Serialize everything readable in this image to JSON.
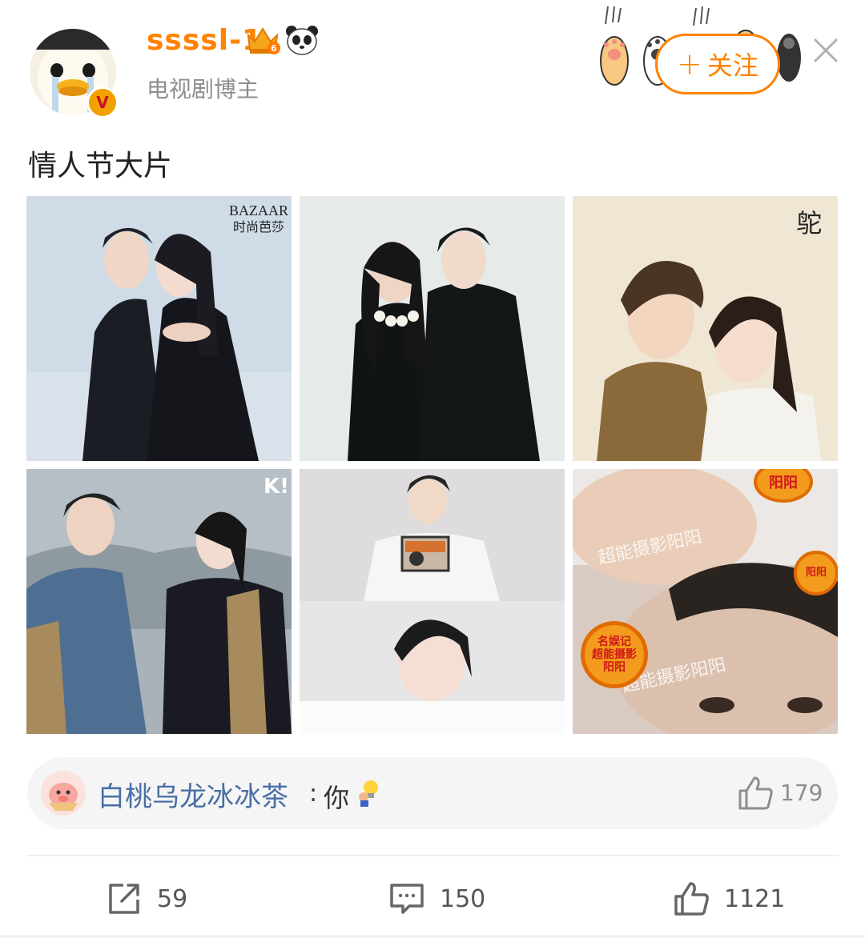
{
  "post": {
    "username": "ssssl-1",
    "subtitle": "电视剧博主",
    "follow_label": "关注",
    "text": "情人节大片"
  },
  "grid": {
    "tiles": [
      {
        "watermark": "BAZAAR\n时尚芭莎"
      },
      {
        "watermark": ""
      },
      {
        "watermark": "鸵"
      },
      {
        "watermark": "K!"
      },
      {
        "watermark": ""
      },
      {
        "watermark": "超能摄影阳阳",
        "stamp": "阳阳",
        "stamp_sub": "名娱记\n超能摄影\n阳阳"
      }
    ]
  },
  "top_comment": {
    "user": "白桃乌龙冰冰茶",
    "separator": ":",
    "text": "你",
    "likes": "179"
  },
  "actions": {
    "repost_count": "59",
    "comment_count": "150",
    "like_count": "1121"
  },
  "colors": {
    "accent": "#ff8200",
    "link": "#4a6fa5",
    "muted": "#8e8e8e"
  },
  "icons": [
    "crown-level-6-icon",
    "panda-icon",
    "paw-icon",
    "close-icon",
    "like-icon",
    "repost-icon",
    "comment-icon",
    "verified-badge-icon"
  ]
}
